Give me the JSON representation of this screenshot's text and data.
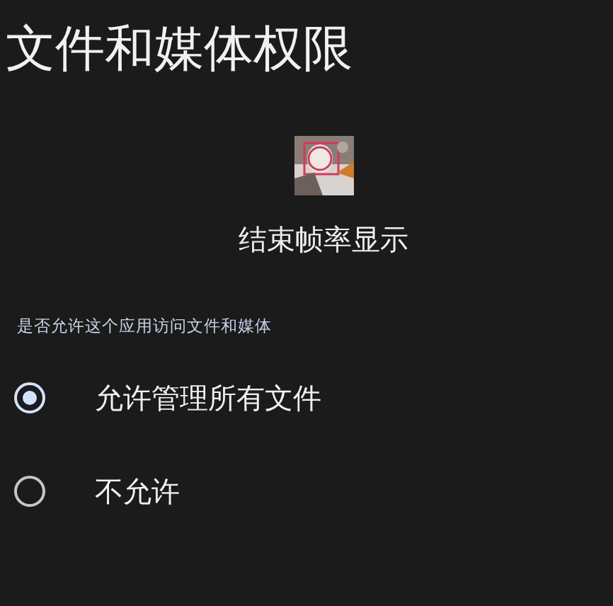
{
  "title": "文件和媒体权限",
  "app": {
    "name": "结束帧率显示"
  },
  "question": "是否允许这个应用访问文件和媒体",
  "options": [
    {
      "label": "允许管理所有文件",
      "selected": true
    },
    {
      "label": "不允许",
      "selected": false
    }
  ]
}
